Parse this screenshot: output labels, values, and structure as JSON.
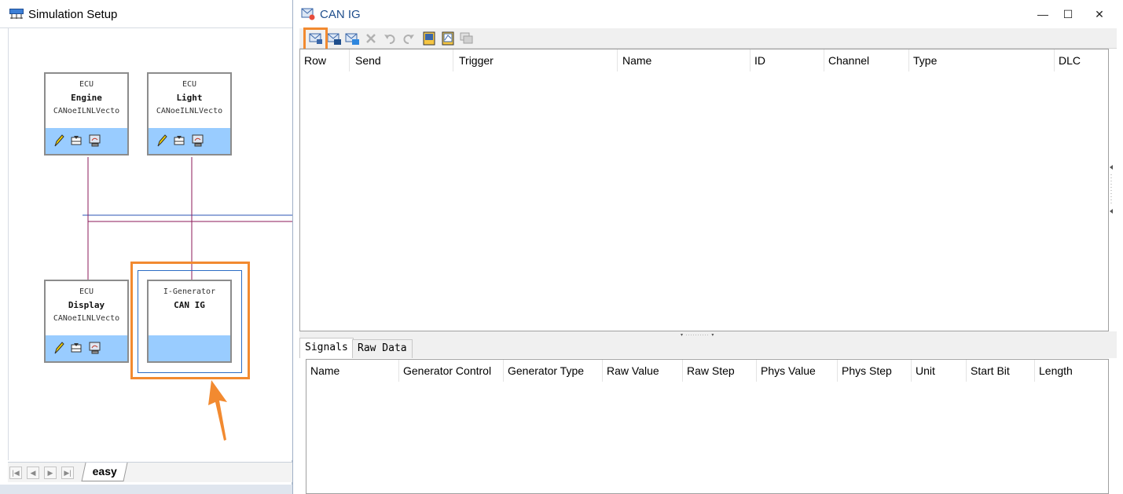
{
  "simulation_setup": {
    "title": "Simulation Setup",
    "nodes": [
      {
        "kind": "ECU",
        "name": "Engine",
        "dbc": "CANoeILNLVecto"
      },
      {
        "kind": "ECU",
        "name": "Light",
        "dbc": "CANoeILNLVecto"
      },
      {
        "kind": "ECU",
        "name": "Display",
        "dbc": "CANoeILNLVecto"
      },
      {
        "kind": "I-Generator",
        "name": "CAN IG"
      }
    ],
    "tabs": {
      "active": "easy"
    },
    "colors": {
      "node_footer": "#99ccff",
      "bus_blue": "#2b54b5",
      "bus_maroon": "#8b1a5a",
      "highlight": "#f28a30"
    }
  },
  "can_ig": {
    "title": "CAN IG",
    "window_controls": {
      "minimize": "—",
      "maximize": "☐",
      "close": "✕"
    },
    "toolbar": [
      "add-frame-icon",
      "add-frame-extended-icon",
      "add-frame-fd-icon",
      "delete-icon",
      "undo-icon",
      "redo-icon",
      "import-icon",
      "export-icon",
      "multi-frame-icon"
    ],
    "message_table": {
      "columns": [
        "Row",
        "Send",
        "Trigger",
        "Name",
        "ID",
        "Channel",
        "Type",
        "DLC"
      ]
    },
    "signal_tabs": [
      "Signals",
      "Raw Data"
    ],
    "signal_table": {
      "columns": [
        "Name",
        "Generator Control",
        "Generator Type",
        "Raw Value",
        "Raw Step",
        "Phys Value",
        "Phys Step",
        "Unit",
        "Start Bit",
        "Length"
      ]
    }
  }
}
